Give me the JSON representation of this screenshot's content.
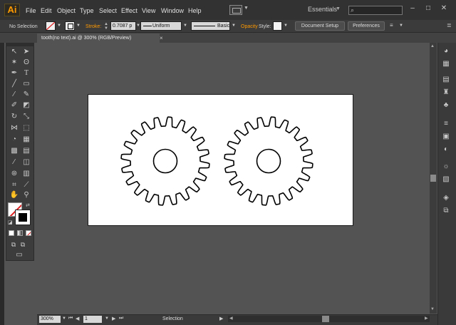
{
  "app": {
    "logo": "Ai"
  },
  "menu": [
    "File",
    "Edit",
    "Object",
    "Type",
    "Select",
    "Effect",
    "View",
    "Window",
    "Help"
  ],
  "workspace": {
    "label": "Essentials"
  },
  "window_controls": [
    "–",
    "□",
    "✕"
  ],
  "control_bar": {
    "selection_label": "No Selection",
    "stroke_label": "Stroke:",
    "stroke_weight": "0.7087 p",
    "profile": "Uniform",
    "brush": "Basic",
    "opacity_label": "Opacity",
    "style_label": "Style:",
    "document_setup": "Document Setup",
    "preferences": "Preferences"
  },
  "document": {
    "tab_title": "tooth(no text).ai @ 300% (RGB/Preview)",
    "close": "×"
  },
  "gears": {
    "count": 2,
    "teeth_per_gear": 20
  },
  "status_bar": {
    "zoom": "300%",
    "page": "1",
    "tool": "Selection"
  },
  "colors": {
    "accent": "#ff9a00",
    "ui_dark": "#323232",
    "canvas_bg": "#535353",
    "artboard": "#ffffff"
  }
}
